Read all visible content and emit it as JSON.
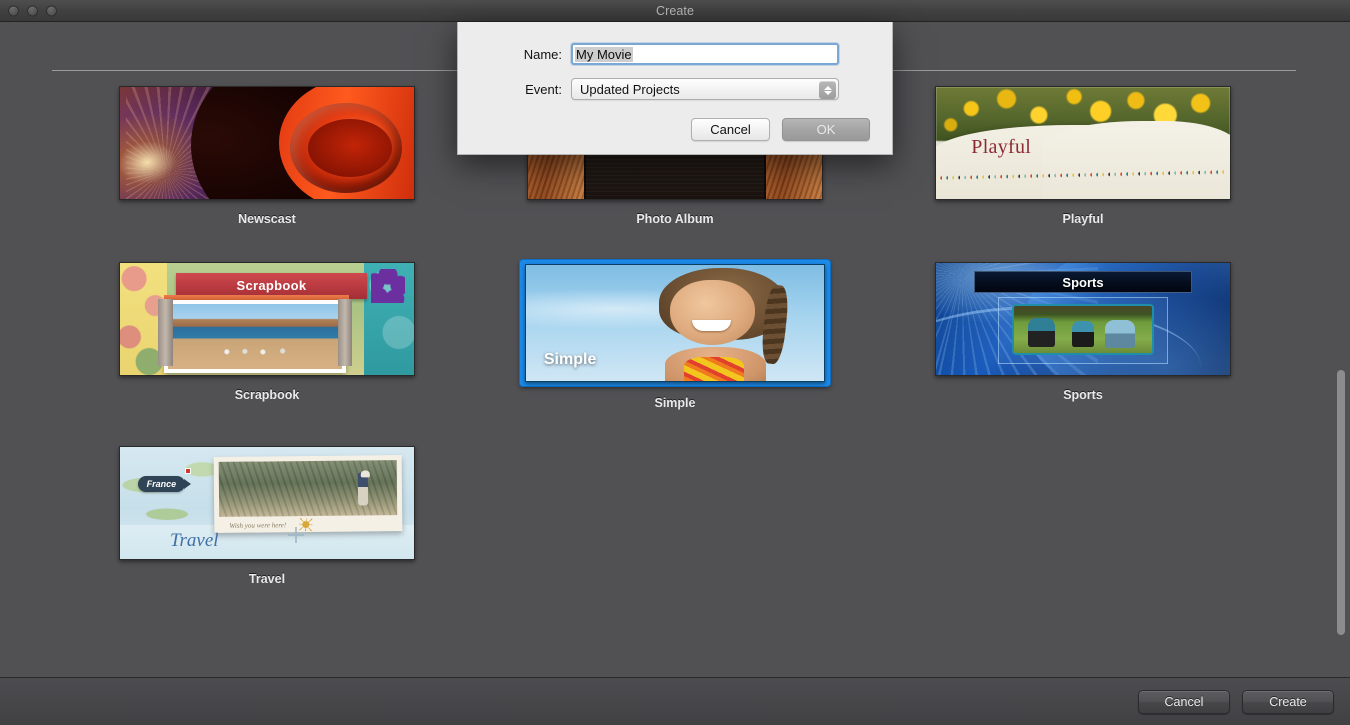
{
  "window": {
    "title": "Create",
    "traffic_lights": [
      "close-button",
      "minimize-button",
      "zoom-button"
    ]
  },
  "themes": [
    {
      "id": "newscast",
      "label": "Newscast",
      "selected": false,
      "overlay_title": ""
    },
    {
      "id": "photoalbum",
      "label": "Photo Album",
      "selected": false,
      "overlay_title": ""
    },
    {
      "id": "playful",
      "label": "Playful",
      "selected": false,
      "overlay_title": "Playful"
    },
    {
      "id": "scrapbook",
      "label": "Scrapbook",
      "selected": false,
      "overlay_title": "Scrapbook"
    },
    {
      "id": "simple",
      "label": "Simple",
      "selected": true,
      "overlay_title": "Simple"
    },
    {
      "id": "sports",
      "label": "Sports",
      "selected": false,
      "overlay_title": "Sports"
    },
    {
      "id": "travel",
      "label": "Travel",
      "selected": false,
      "overlay_title": "Travel"
    }
  ],
  "travel_art": {
    "location_tag": "France",
    "caption": "Wish you were here!",
    "script_title": "Travel"
  },
  "dialog": {
    "name_label": "Name:",
    "name_value": "My Movie",
    "event_label": "Event:",
    "event_value": "Updated Projects",
    "cancel_label": "Cancel",
    "ok_label": "OK"
  },
  "bottom_bar": {
    "cancel_label": "Cancel",
    "create_label": "Create"
  },
  "colors": {
    "window_background": "#515154",
    "selection_blue": "#1c8ae8",
    "dialog_background": "#ececec",
    "focus_ring": "#7aa7d4"
  }
}
